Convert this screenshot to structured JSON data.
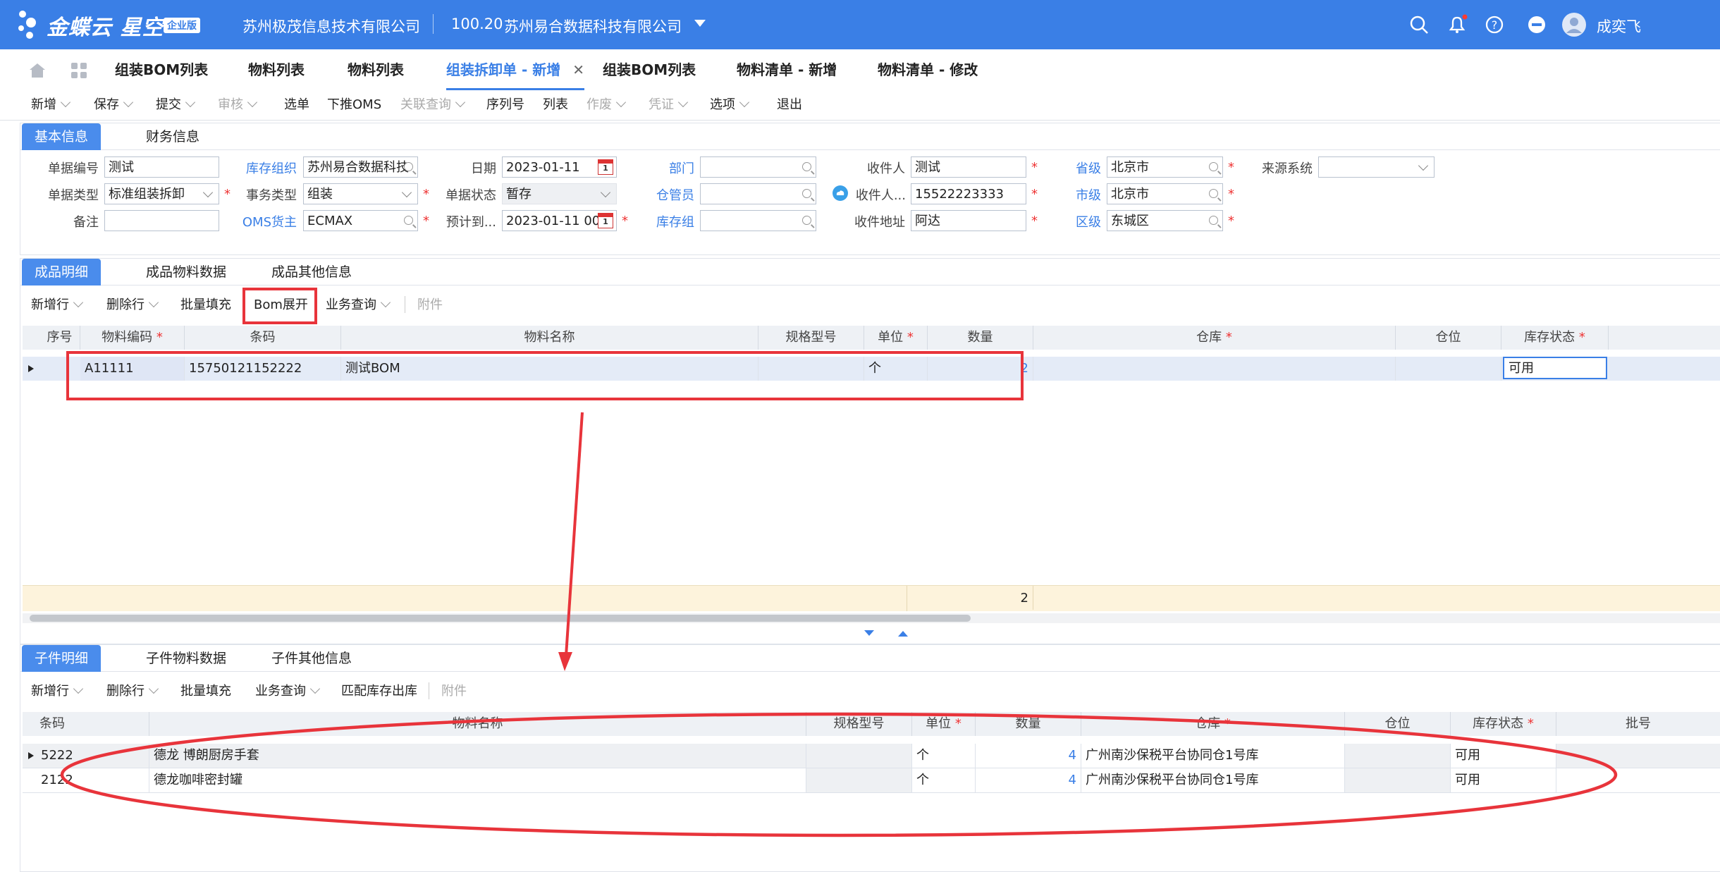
{
  "header": {
    "logo": "金蝶云 星空",
    "edition_badge": "企业版",
    "company1": "苏州极茂信息技术有限公司",
    "account_code": "100.20",
    "company2": "苏州易合数据科技有限公司",
    "user_name": "成奕飞",
    "notification_dot_color": "#ff3b30"
  },
  "tabs": [
    {
      "label": "组装BOM列表"
    },
    {
      "label": "物料列表"
    },
    {
      "label": "物料列表"
    },
    {
      "label": "组装拆卸单 - 新增"
    },
    {
      "label": "组装BOM列表"
    },
    {
      "label": "物料清单 - 新增"
    },
    {
      "label": "物料清单 - 修改"
    }
  ],
  "toolbar": [
    {
      "label": "新增"
    },
    {
      "label": "保存"
    },
    {
      "label": "提交"
    },
    {
      "label": "审核"
    },
    {
      "label": "选单"
    },
    {
      "label": "下推OMS"
    },
    {
      "label": "关联查询"
    },
    {
      "label": "序列号"
    },
    {
      "label": "列表"
    },
    {
      "label": "作废"
    },
    {
      "label": "凭证"
    },
    {
      "label": "选项"
    },
    {
      "label": "退出"
    }
  ],
  "basic_tabs": [
    "基本信息",
    "财务信息"
  ],
  "form": {
    "doc_no_label": "单据编号",
    "doc_no": "测试",
    "doc_type_label": "单据类型",
    "doc_type": "标准组装拆卸",
    "remark_label": "备注",
    "remark": "",
    "stock_org_label": "库存组织",
    "stock_org": "苏州易合数据科技",
    "biz_type_label": "事务类型",
    "biz_type": "组装",
    "oms_owner_label": "OMS货主",
    "oms_owner": "ECMAX",
    "date_label": "日期",
    "date": "2023-01-11",
    "doc_status_label": "单据状态",
    "doc_status": "暂存",
    "eta_label": "预计到...",
    "eta": "2023-01-11 00",
    "calendar_day": "1",
    "dept_label": "部门",
    "dept": "",
    "keeper_label": "仓管员",
    "keeper": "",
    "stock_group_label": "库存组",
    "stock_group": "",
    "receiver_label": "收件人",
    "receiver": "测试",
    "receiver_phone_label": "收件人...",
    "receiver_phone": "15522223333",
    "address_label": "收件地址",
    "address": "阿达",
    "province_label": "省级",
    "province": "北京市",
    "city_label": "市级",
    "city": "北京市",
    "district_label": "区级",
    "district": "东城区",
    "source_label": "来源系统",
    "source": ""
  },
  "product_tabs": [
    "成品明细",
    "成品物料数据",
    "成品其他信息"
  ],
  "product_toolbar": [
    {
      "label": "新增行"
    },
    {
      "label": "删除行"
    },
    {
      "label": "批量填充"
    },
    {
      "label": "Bom展开"
    },
    {
      "label": "业务查询"
    },
    {
      "label": "附件"
    }
  ],
  "product_grid": {
    "headers": [
      "序号",
      "物料编码",
      "条码",
      "物料名称",
      "规格型号",
      "单位",
      "数量",
      "仓库",
      "仓位",
      "库存状态"
    ],
    "rows": [
      {
        "code": "A11111",
        "barcode": "15750121152222",
        "name": "测试BOM",
        "spec": "",
        "unit": "个",
        "qty": "2",
        "warehouse": "",
        "location": "",
        "status": "可用"
      }
    ],
    "total_qty": "2"
  },
  "child_tabs": [
    "子件明细",
    "子件物料数据",
    "子件其他信息"
  ],
  "child_toolbar": [
    {
      "label": "新增行"
    },
    {
      "label": "删除行"
    },
    {
      "label": "批量填充"
    },
    {
      "label": "业务查询"
    },
    {
      "label": "匹配库存出库"
    },
    {
      "label": "附件"
    }
  ],
  "child_grid": {
    "headers": [
      "条码",
      "物料名称",
      "规格型号",
      "单位",
      "数量",
      "仓库",
      "仓位",
      "库存状态",
      "批号"
    ],
    "rows": [
      {
        "barcode": "5222",
        "name": "德龙 博朗厨房手套",
        "spec": "",
        "unit": "个",
        "qty": "4",
        "warehouse": "广州南沙保税平台协同仓1号库",
        "location": "",
        "status": "可用",
        "batch": ""
      },
      {
        "barcode": "2122",
        "name": "德龙咖啡密封罐",
        "spec": "",
        "unit": "个",
        "qty": "4",
        "warehouse": "广州南沙保税平台协同仓1号库",
        "location": "",
        "status": "可用",
        "batch": ""
      }
    ]
  },
  "colors": {
    "brand": "#3a7fe6",
    "annotation": "#e8343b",
    "total_row": "#fdf3dc"
  }
}
